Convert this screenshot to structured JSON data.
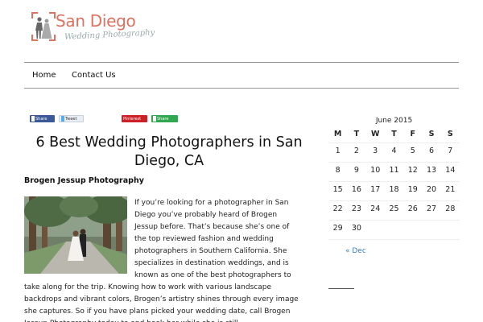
{
  "logo": {
    "title": "San Diego",
    "subtitle": "Wedding Photography"
  },
  "nav": {
    "items": [
      {
        "label": "Home"
      },
      {
        "label": "Contact Us"
      }
    ]
  },
  "share": {
    "facebook": "Share",
    "twitter": "Tweet",
    "pinterest": "Pinterest",
    "share": "Share",
    "colors": {
      "facebook": "#3b5998",
      "twitter": "#e8eef4",
      "pinterest": "#cb2027",
      "share": "#2fa84f"
    }
  },
  "post": {
    "title": "6 Best Wedding Photographers in San Diego, CA",
    "subheading": "Brogen Jessup Photography",
    "body": "If you’re looking for a photographer in San Diego you’ve probably heard of Brogen Jessup before. That’s because she’s one of the top reviewed fashion and wedding photographers in Southern California. She specializes in destination weddings, and is known as one of the best photographers to take along for the trip.  Knowing how to work with various landscape backdrops and vibrant colors, Brogen’s artistry shines through every image she captures. So if you have plans picked your wedding date, call Brogen Jessup Photography today to and book her while she is still"
  },
  "calendar": {
    "caption": "June 2015",
    "weekdays": [
      "M",
      "T",
      "W",
      "T",
      "F",
      "S",
      "S"
    ],
    "weeks": [
      [
        "1",
        "2",
        "3",
        "4",
        "5",
        "6",
        "7"
      ],
      [
        "8",
        "9",
        "10",
        "11",
        "12",
        "13",
        "14"
      ],
      [
        "15",
        "16",
        "17",
        "18",
        "19",
        "20",
        "21"
      ],
      [
        "22",
        "23",
        "24",
        "25",
        "26",
        "27",
        "28"
      ],
      [
        "29",
        "30",
        "",
        "",
        "",
        "",
        ""
      ]
    ],
    "prev_link": "« Dec"
  },
  "colors": {
    "accent": "#e07060",
    "link": "#3a7bbf"
  }
}
